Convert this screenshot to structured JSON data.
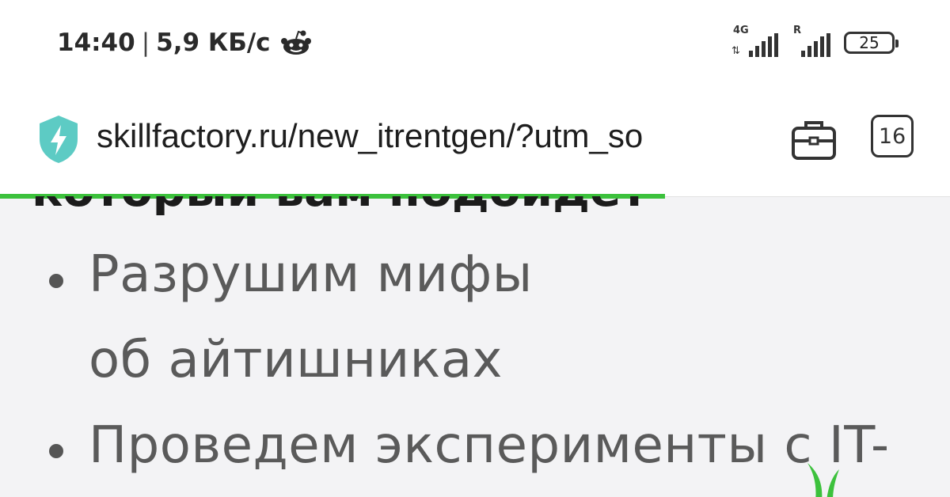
{
  "status_bar": {
    "time": "14:40",
    "separator": "|",
    "speed": "5,9 КБ/с",
    "network_1_tag": "4G",
    "network_2_tag": "R",
    "battery": "25",
    "icons": [
      "reddit-icon",
      "signal-icon",
      "roaming-signal-icon",
      "battery-icon"
    ]
  },
  "browser": {
    "url": "skillfactory.ru/new_itrentgen/?utm_so",
    "tab_count": "16",
    "icons": [
      "shield-bolt-icon",
      "briefcase-icon"
    ],
    "load_progress_percent": 70,
    "accent_color": "#3cc13c"
  },
  "page": {
    "cut_heading": "который вам подойдёт",
    "items": [
      {
        "lines": [
          "Разрушим мифы",
          "об айтишниках"
        ]
      },
      {
        "lines": [
          "Проведем эксперименты с IT-"
        ]
      }
    ]
  }
}
